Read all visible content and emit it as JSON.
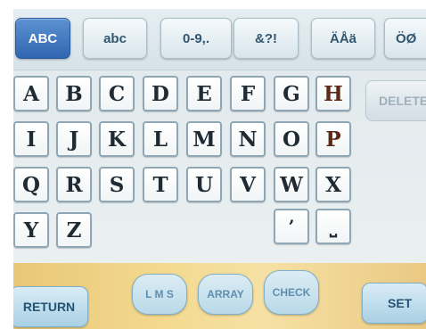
{
  "mode_tabs": [
    {
      "label": "ABC",
      "active": true
    },
    {
      "label": "abc",
      "active": false
    },
    {
      "label": "0-9,.",
      "active": false
    },
    {
      "label": "&?!",
      "active": false
    },
    {
      "label": "ÄÅä",
      "active": false
    },
    {
      "label": "ÖØ",
      "active": false
    }
  ],
  "keys": {
    "row1": [
      "A",
      "B",
      "C",
      "D",
      "E",
      "F",
      "G",
      "H"
    ],
    "row2": [
      "I",
      "J",
      "K",
      "L",
      "M",
      "N",
      "O",
      "P"
    ],
    "row3": [
      "Q",
      "R",
      "S",
      "T",
      "U",
      "V",
      "W",
      "X"
    ],
    "row4": [
      "Y",
      "Z"
    ],
    "row4_right": [
      "’",
      "⎵"
    ]
  },
  "delete_label": "DELETE",
  "bottom": {
    "return_label": "RETURN",
    "lms_label": "L M S",
    "array_label": "ARRAY",
    "check_label": "CHECK",
    "set_label": "SET"
  }
}
